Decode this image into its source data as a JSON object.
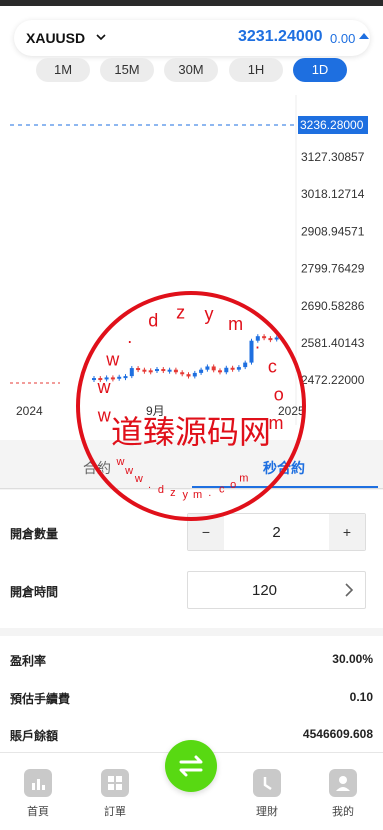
{
  "ticker": {
    "symbol": "XAUUSD",
    "price": "3231.24000",
    "change": "0.00"
  },
  "timeframes": [
    {
      "label": "1M",
      "active": false
    },
    {
      "label": "15M",
      "active": false
    },
    {
      "label": "30M",
      "active": false
    },
    {
      "label": "1H",
      "active": false
    },
    {
      "label": "1D",
      "active": true
    }
  ],
  "chart_data": {
    "type": "candlestick",
    "title": "",
    "xlabel": "",
    "ylabel": "",
    "ylim": [
      2440,
      3260
    ],
    "y_ticks": [
      "3127.30857",
      "3018.12714",
      "2908.94571",
      "2799.76429",
      "2690.58286",
      "2581.40143",
      "2472.22000"
    ],
    "current_price_label": "3236.28000",
    "x_ticks": [
      "2024",
      "9月",
      "2025"
    ],
    "candles": [
      {
        "open": 2472,
        "close": 2474
      },
      {
        "open": 2474,
        "close": 2473
      },
      {
        "open": 2473,
        "close": 2476
      },
      {
        "open": 2476,
        "close": 2475
      },
      {
        "open": 2475,
        "close": 2478
      },
      {
        "open": 2478,
        "close": 2480
      },
      {
        "open": 2480,
        "close": 2505
      },
      {
        "open": 2505,
        "close": 2500
      },
      {
        "open": 2500,
        "close": 2498
      },
      {
        "open": 2498,
        "close": 2496
      },
      {
        "open": 2496,
        "close": 2502
      },
      {
        "open": 2502,
        "close": 2498
      },
      {
        "open": 2498,
        "close": 2500
      },
      {
        "open": 2500,
        "close": 2492
      },
      {
        "open": 2492,
        "close": 2486
      },
      {
        "open": 2486,
        "close": 2479
      },
      {
        "open": 2479,
        "close": 2490
      },
      {
        "open": 2490,
        "close": 2500
      },
      {
        "open": 2500,
        "close": 2510
      },
      {
        "open": 2510,
        "close": 2498
      },
      {
        "open": 2498,
        "close": 2492
      },
      {
        "open": 2492,
        "close": 2506
      },
      {
        "open": 2506,
        "close": 2500
      },
      {
        "open": 2500,
        "close": 2508
      },
      {
        "open": 2508,
        "close": 2522
      },
      {
        "open": 2522,
        "close": 2590
      },
      {
        "open": 2590,
        "close": 2604
      },
      {
        "open": 2604,
        "close": 2598
      },
      {
        "open": 2598,
        "close": 2596
      },
      {
        "open": 2596,
        "close": 2600
      }
    ]
  },
  "tabs": {
    "contract": "合約",
    "second_contract": "秒合約"
  },
  "form": {
    "quantity_label": "開倉數量",
    "quantity_minus": "−",
    "quantity_value": "2",
    "quantity_plus": "+",
    "time_label": "開倉時間",
    "time_value": "120"
  },
  "info": {
    "profit_rate_label": "盈利率",
    "profit_rate_value": "30.00%",
    "fee_label": "預估手續費",
    "fee_value": "0.10",
    "balance_label": "賬戶餘額",
    "balance_value": "4546609.608"
  },
  "nav": {
    "home": "首頁",
    "orders": "訂單",
    "finance": "理財",
    "mine": "我的"
  },
  "watermark": {
    "main_text": "道臻源码网",
    "ring_text": "www.dzym.com",
    "color": "#e0101a"
  },
  "colors": {
    "accent": "#1e6fe0",
    "up": "#1e6fe0",
    "down": "#e53935",
    "center_button": "#58d912"
  }
}
